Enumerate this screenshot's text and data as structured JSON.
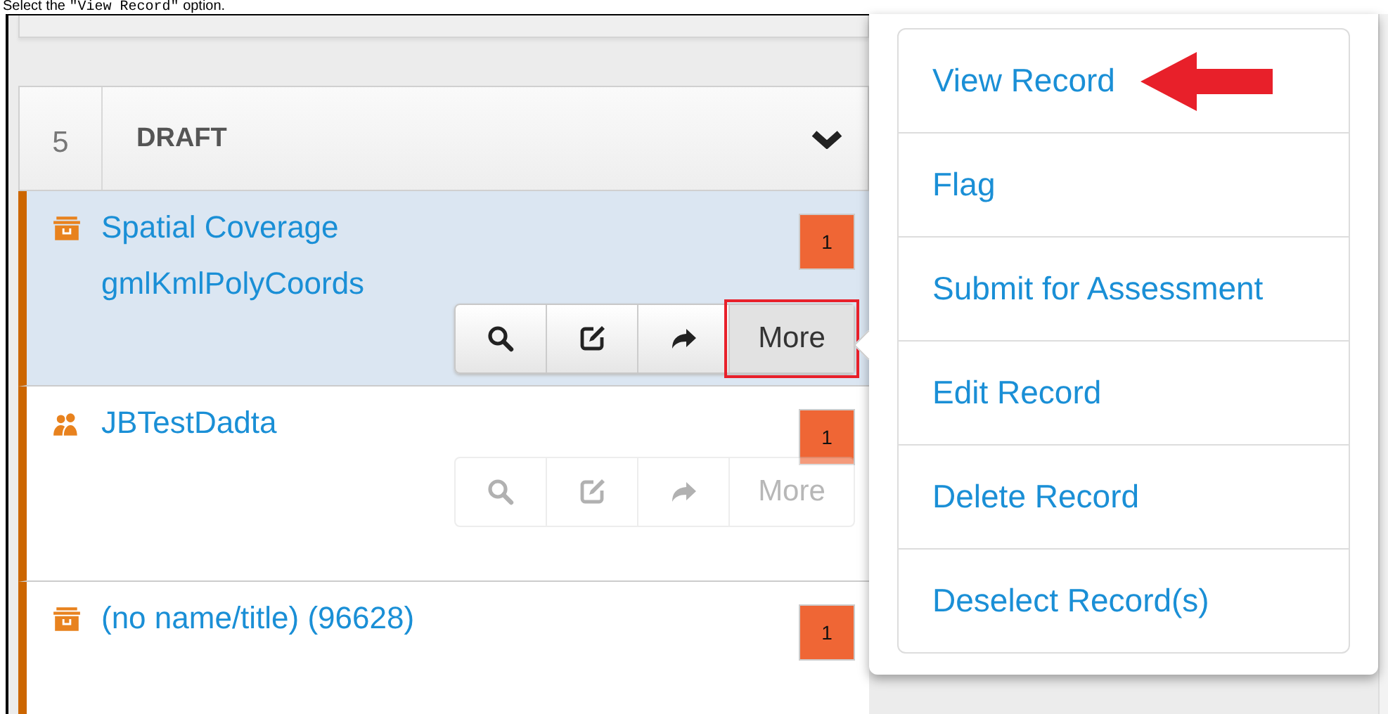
{
  "caption": {
    "before": "Select the",
    "code": "\"View Record\"",
    "after": "option."
  },
  "group": {
    "count": "5",
    "title": "DRAFT",
    "expanded": true
  },
  "records": [
    {
      "kind": "archive",
      "title": "Spatial Coverage gmlKmlPolyCoords",
      "badge": "1",
      "selected": true,
      "actions": {
        "disabled": false,
        "more": "More",
        "more_highlighted": true
      }
    },
    {
      "kind": "people",
      "title": "JBTestDadta",
      "badge": "1",
      "selected": false,
      "actions": {
        "disabled": true,
        "more": "More",
        "more_highlighted": false
      }
    },
    {
      "kind": "archive",
      "title": "(no name/title) (96628)",
      "badge": "1",
      "selected": false
    }
  ],
  "menu": {
    "items": [
      {
        "label": "View Record",
        "annotated": true
      },
      {
        "label": "Flag",
        "annotated": false
      },
      {
        "label": "Submit for Assessment",
        "annotated": false
      },
      {
        "label": "Edit Record",
        "annotated": false
      },
      {
        "label": "Delete Record",
        "annotated": false
      },
      {
        "label": "Deselect Record(s)",
        "annotated": false
      }
    ]
  }
}
